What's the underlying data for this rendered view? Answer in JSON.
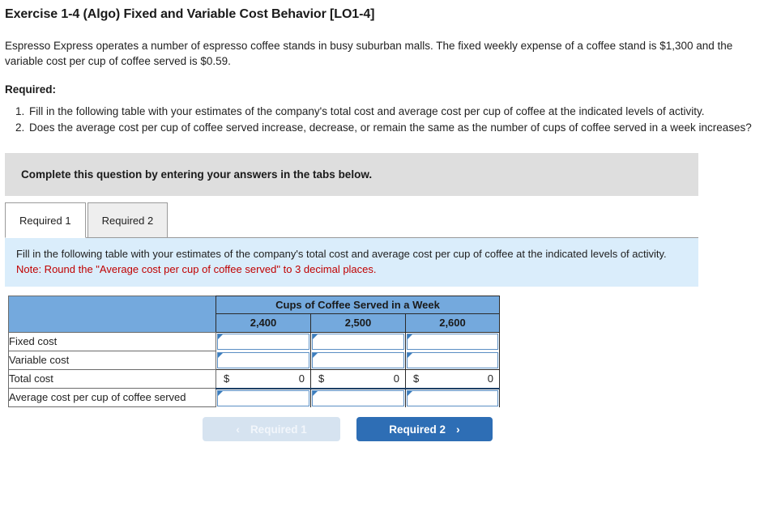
{
  "exercise": {
    "title": "Exercise 1-4 (Algo) Fixed and Variable Cost Behavior [LO1-4]",
    "intro": "Espresso Express operates a number of espresso coffee stands in busy suburban malls. The fixed weekly expense of a coffee stand is $1,300 and the variable cost per cup of coffee served is $0.59.",
    "required_heading": "Required:",
    "required_items": [
      "Fill in the following table with your estimates of the company's total cost and average cost per cup of coffee at the indicated levels of activity.",
      "Does the average cost per cup of coffee served increase, decrease, or remain the same as the number of cups of coffee served in a week increases?"
    ]
  },
  "complete_banner": {
    "text": "Complete this question by entering your answers in the tabs below."
  },
  "tabs": [
    {
      "label": "Required 1",
      "active": true
    },
    {
      "label": "Required 2",
      "active": false
    }
  ],
  "instruction_panel": {
    "text": "Fill in the following table with your estimates of the company's total cost and average cost per cup of coffee at the indicated levels of activity.",
    "note": "Note: Round the \"Average cost per cup of coffee served\" to 3 decimal places.",
    "note_color": "#c00000",
    "background_color": "#daedfb"
  },
  "table": {
    "group_header": "Cups of Coffee Served in a Week",
    "column_headers": [
      "2,400",
      "2,500",
      "2,600"
    ],
    "header_background": "#74a9dd",
    "rows": [
      {
        "label": "Fixed cost",
        "type": "input",
        "values": [
          "",
          "",
          ""
        ]
      },
      {
        "label": "Variable cost",
        "type": "input",
        "values": [
          "",
          "",
          ""
        ]
      },
      {
        "label": "Total cost",
        "type": "money",
        "currency": "$",
        "values": [
          "0",
          "0",
          "0"
        ]
      },
      {
        "label": "Average cost per cup of coffee served",
        "type": "input",
        "values": [
          "",
          "",
          ""
        ]
      }
    ]
  },
  "footer_buttons": {
    "prev": {
      "label": "Required 1",
      "icon": "chevron-left-icon",
      "glyph": "‹",
      "enabled": false,
      "color": "#d6e3f0"
    },
    "next": {
      "label": "Required 2",
      "icon": "chevron-right-icon",
      "glyph": "›",
      "enabled": true,
      "color": "#2e6eb5"
    }
  }
}
